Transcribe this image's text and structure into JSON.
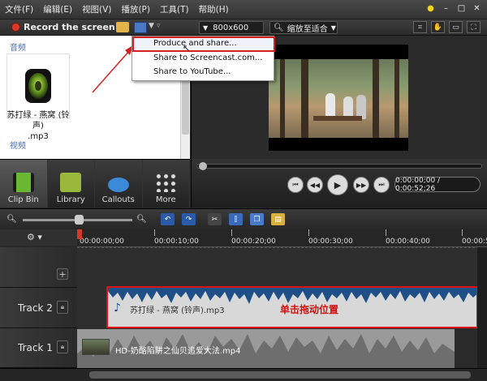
{
  "menubar": {
    "items": [
      "文件(F)",
      "编辑(E)",
      "视图(V)",
      "播放(P)",
      "工具(T)",
      "帮助(H)"
    ]
  },
  "toolbar": {
    "record_label": "Record the screen",
    "dimensions": "800x600",
    "zoom_label": "缩放至适合"
  },
  "dropdown": {
    "items": [
      "Produce and share...",
      "Share to Screencast.com...",
      "Share to YouTube..."
    ]
  },
  "clipbin": {
    "audio_section": "音频",
    "video_section": "视频",
    "clip_name_line1": "苏打绿 - 燕窝 (铃声)",
    "clip_name_line2": ".mp3"
  },
  "tabs": [
    "Clip Bin",
    "Library",
    "Callouts",
    "More"
  ],
  "player": {
    "timecode": "0:00:00;00 / 0:00:52;26"
  },
  "ruler": {
    "ticks": [
      "00:00:00;00",
      "00:00:10;00",
      "00:00:20;00",
      "00:00:30;00",
      "00:00:40;00",
      "00:00:5"
    ]
  },
  "tracks": {
    "track2_name": "Track 2",
    "track1_name": "Track 1",
    "audio_clip": "苏打绿 - 燕窝 (铃声).mp3",
    "video_clip": "HD-奶酪陷阱之仙贝追爱大法.mp4"
  },
  "annotation": {
    "drag_note": "单击拖动位置"
  },
  "colors": {
    "accent_red": "#d62020",
    "waveform_blue": "#1e4f86",
    "dark_bg": "#2a2a2a"
  }
}
